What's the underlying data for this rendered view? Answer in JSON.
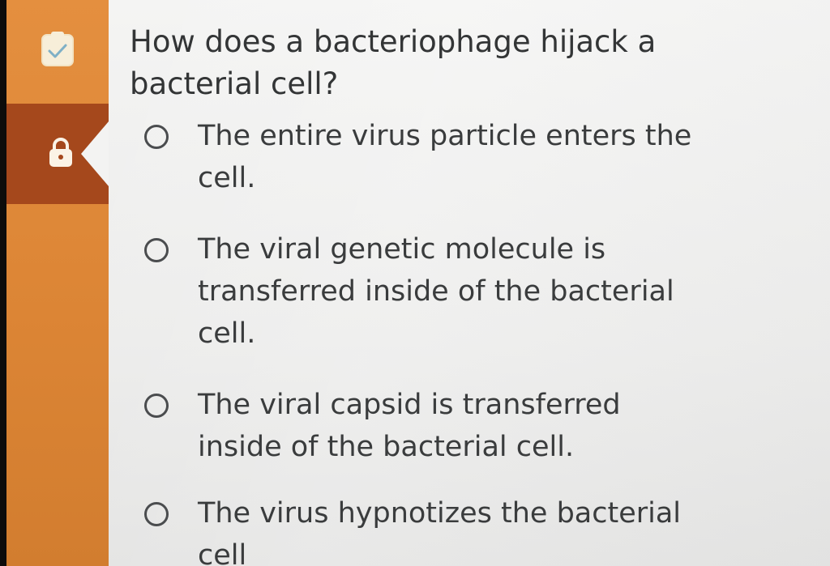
{
  "question": {
    "text": "How does a bacteriophage hijack a bacterial cell?"
  },
  "options": [
    {
      "label": "The entire virus particle enters the cell."
    },
    {
      "label": "The viral genetic molecule is transferred inside of the bacterial cell."
    },
    {
      "label": "The viral capsid is transferred inside of the bacterial cell."
    },
    {
      "label": "The virus hypnotizes the bacterial cell"
    }
  ],
  "sidebar": {
    "items": [
      {
        "icon": "clipboard-check-icon",
        "state": "completed"
      },
      {
        "icon": "lock-icon",
        "state": "locked-active"
      }
    ]
  },
  "colors": {
    "sidebar": "#e48f3f",
    "sidebar_active": "#a5481c",
    "content_bg": "#f0f0ef",
    "text": "#333536"
  }
}
